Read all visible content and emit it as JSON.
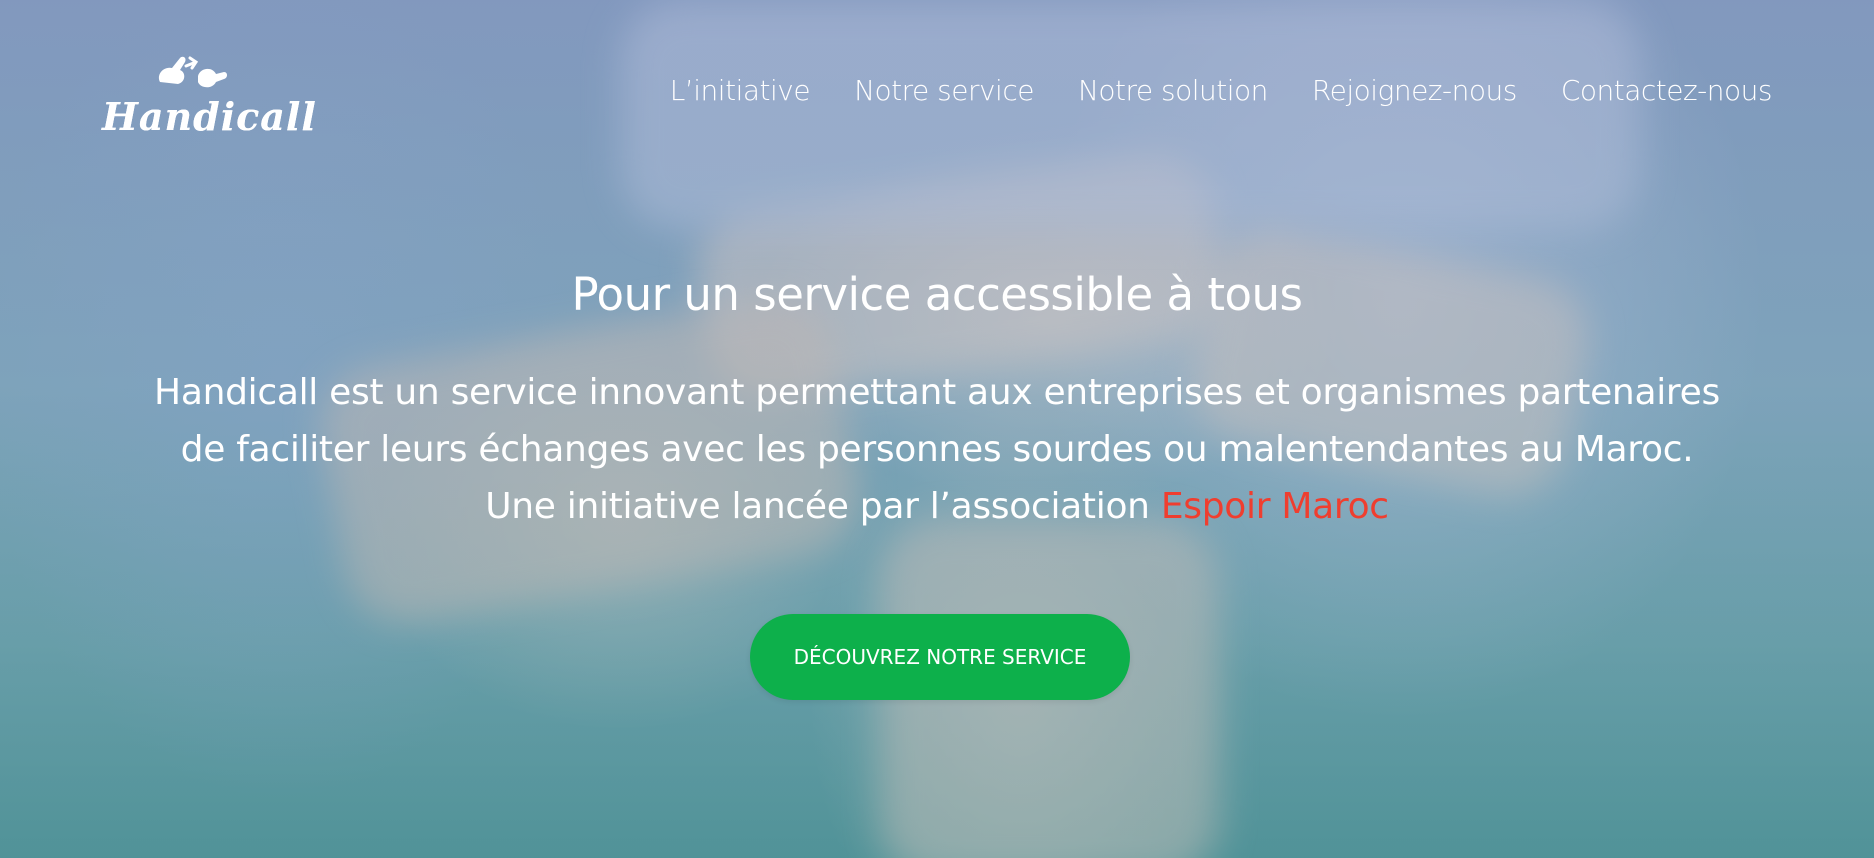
{
  "brand": {
    "name": "Handicall",
    "logo_icon": "signing-hands-icon"
  },
  "nav": {
    "items": [
      {
        "label": "L’initiative"
      },
      {
        "label": "Notre service"
      },
      {
        "label": "Notre solution"
      },
      {
        "label": "Rejoignez-nous"
      },
      {
        "label": "Contactez-nous"
      }
    ]
  },
  "hero": {
    "title": "Pour un service accessible à tous",
    "description_line1": "Handicall est un service innovant permettant aux entreprises et organismes partenaires",
    "description_line2": "de faciliter leurs échanges avec les personnes sourdes ou malentendantes au Maroc.",
    "description_line3_prefix": "Une initiative lancée par l’association ",
    "association_name": "Espoir Maroc",
    "cta_label": "DÉCOUVREZ NOTRE SERVICE"
  },
  "colors": {
    "accent_red": "#ef3e2f",
    "cta_green": "#0db04b",
    "text": "#ffffff"
  }
}
